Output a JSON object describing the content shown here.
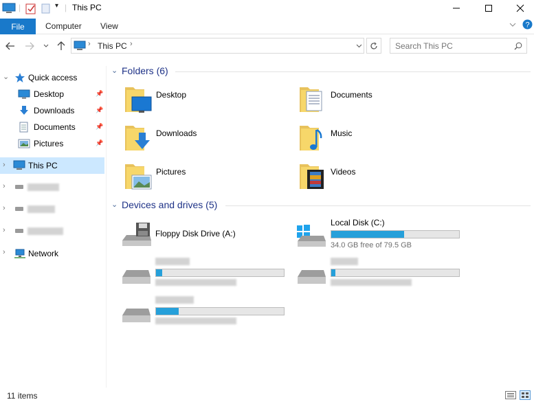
{
  "window": {
    "title": "This PC",
    "accent": "#1979ca"
  },
  "ribbon": {
    "file_label": "File",
    "tabs": [
      "Computer",
      "View"
    ]
  },
  "address": {
    "location": "This PC",
    "search_placeholder": "Search This PC"
  },
  "nav": {
    "quick_access": "Quick access",
    "quick_items": [
      {
        "label": "Desktop",
        "icon": "desktop-icon"
      },
      {
        "label": "Downloads",
        "icon": "downloads-icon"
      },
      {
        "label": "Documents",
        "icon": "documents-icon"
      },
      {
        "label": "Pictures",
        "icon": "pictures-icon"
      }
    ],
    "this_pc": "This PC",
    "network": "Network"
  },
  "folders": {
    "header": "Folders (6)",
    "items": [
      {
        "label": "Desktop",
        "icon": "desktop-folder-icon"
      },
      {
        "label": "Documents",
        "icon": "documents-folder-icon"
      },
      {
        "label": "Downloads",
        "icon": "downloads-folder-icon"
      },
      {
        "label": "Music",
        "icon": "music-folder-icon"
      },
      {
        "label": "Pictures",
        "icon": "pictures-folder-icon"
      },
      {
        "label": "Videos",
        "icon": "videos-folder-icon"
      }
    ]
  },
  "drives": {
    "header": "Devices and drives (5)",
    "floppy": {
      "label": "Floppy Disk Drive (A:)"
    },
    "local": {
      "label": "Local Disk (C:)",
      "free_text": "34.0 GB free of 79.5 GB",
      "used_fraction": 0.57
    },
    "blurred_used_fractions": [
      0.05,
      0.03,
      0.18
    ]
  },
  "status": {
    "item_count": "11 items"
  }
}
